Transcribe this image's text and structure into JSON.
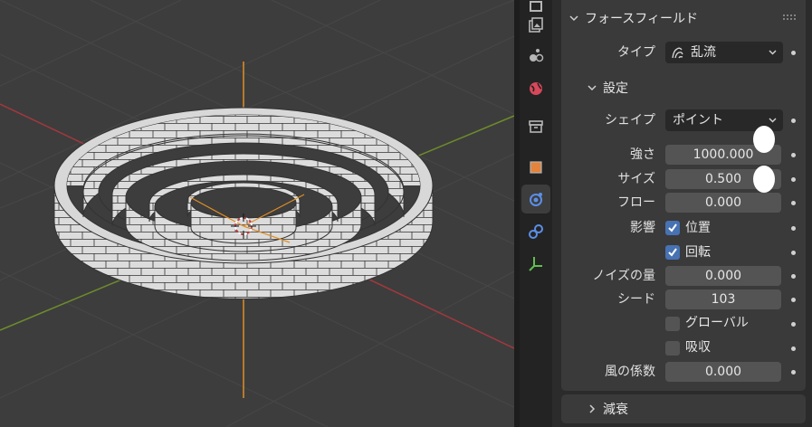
{
  "panel": {
    "title": "フォースフィールド",
    "type_label": "タイプ",
    "type_value": "乱流",
    "settings_header": "設定",
    "shape_label": "シェイプ",
    "shape_value": "ポイント",
    "strength_label": "強さ",
    "strength_value": "1000.000",
    "size_label": "サイズ",
    "size_value": "0.500",
    "flow_label": "フロー",
    "flow_value": "0.000",
    "affect_label": "影響",
    "location_label": "位置",
    "location_checked": true,
    "rotation_label": "回転",
    "rotation_checked": true,
    "noise_label": "ノイズの量",
    "noise_value": "0.000",
    "seed_label": "シード",
    "seed_value": "103",
    "global_label": "グローバル",
    "global_checked": false,
    "absorb_label": "吸収",
    "absorb_checked": false,
    "wind_label": "風の係数",
    "wind_value": "0.000",
    "falloff_header": "減衰"
  },
  "tabs": [
    "texture-icon",
    "particles-icon",
    "world-icon",
    "collection-icon",
    "object-icon",
    "physics-icon",
    "object-data-icon",
    "empty-axes-icon"
  ],
  "colors": {
    "accent": "#4772b3",
    "x_axis": "#a3383e",
    "y_axis": "#6d8b2c",
    "z_axis": "#e08e24",
    "object": "#e8e8e8"
  }
}
